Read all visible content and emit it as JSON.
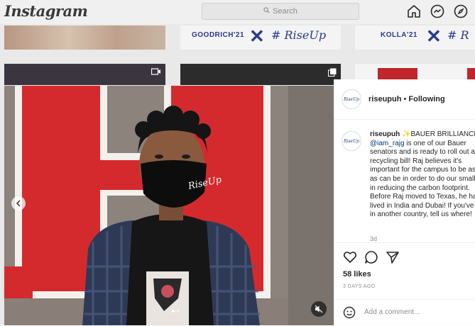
{
  "topbar": {
    "logo": "Instagram",
    "search_placeholder": "Search"
  },
  "feed": {
    "tiles": [
      {
        "brand": "GOODRICH'21",
        "tag": "# RiseUp"
      },
      {
        "brand": "KOLLA'21",
        "tag": "# R"
      }
    ]
  },
  "post": {
    "username": "riseupuh",
    "follow_separator": " • ",
    "follow_status": "Following",
    "avatar_text": "RiseUp",
    "mask_text": "RiseUp",
    "caption": {
      "username": "riseupuh",
      "headline": " ✨BAUER BRILLIANCE",
      "mention": "@iam_rajg",
      "lines": [
        " is one of our Bauer",
        "senators and is ready to roll out a",
        "recycling bill! Raj believes it's",
        "important for the campus to be as green",
        "as can be in order to do our small part",
        "in reducing the carbon footprint.",
        "Before Raj moved to Texas, he has",
        "lived in India and Dubai! If you've lived",
        "in another country, tell us where!"
      ],
      "age": "3d"
    },
    "likes": "58 likes",
    "date": "3 DAYS AGO",
    "comment_placeholder": "Add a comment..."
  },
  "colors": {
    "accent_red": "#d42a2e",
    "brand_blue": "#2b3a8c",
    "link_blue": "#00376b"
  }
}
